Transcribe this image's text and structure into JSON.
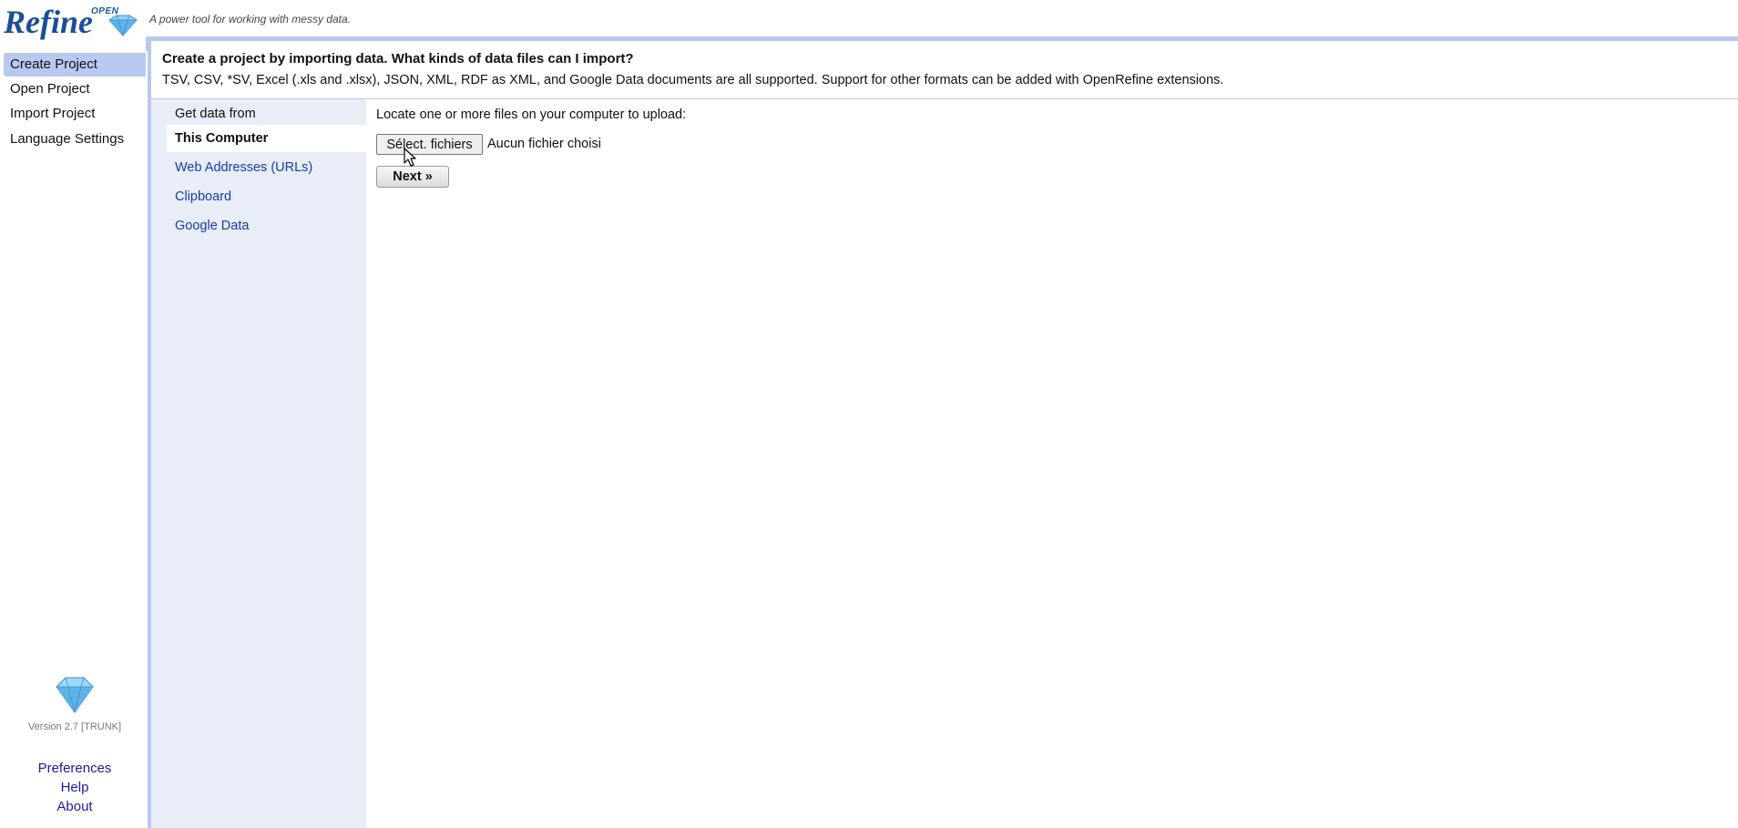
{
  "header": {
    "logo_small": "OPEN",
    "logo_main": "Refine",
    "tagline": "A power tool for working with messy data."
  },
  "sidebar": {
    "items": [
      {
        "label": "Create Project",
        "active": true
      },
      {
        "label": "Open Project",
        "active": false
      },
      {
        "label": "Import Project",
        "active": false
      },
      {
        "label": "Language Settings",
        "active": false
      }
    ],
    "version": "Version 2.7 [TRUNK]",
    "footer_links": [
      "Preferences",
      "Help",
      "About"
    ]
  },
  "main": {
    "title": "Create a project by importing data. What kinds of data files can I import?",
    "subtitle": "TSV, CSV, *SV, Excel (.xls and .xlsx), JSON, XML, RDF as XML, and Google Data documents are all supported. Support for other formats can be added with OpenRefine extensions.",
    "sources": {
      "heading": "Get data from",
      "items": [
        {
          "label": "This Computer",
          "active": true
        },
        {
          "label": "Web Addresses (URLs)",
          "active": false
        },
        {
          "label": "Clipboard",
          "active": false
        },
        {
          "label": "Google Data",
          "active": false
        }
      ]
    },
    "upload": {
      "locate_label": "Locate one or more files on your computer to upload:",
      "file_button_label": "Sélect. fichiers",
      "file_status": "Aucun fichier choisi",
      "next_label": "Next »"
    }
  },
  "colors": {
    "accent": "#b8c8f0",
    "source_panel_bg": "#e8edf8",
    "link": "#1a3ca8",
    "logo_blue": "#1a4f96"
  },
  "icons": {
    "logo_gem": "diamond-icon",
    "footer_gem": "diamond-icon",
    "pointer": "mouse-pointer-icon"
  }
}
